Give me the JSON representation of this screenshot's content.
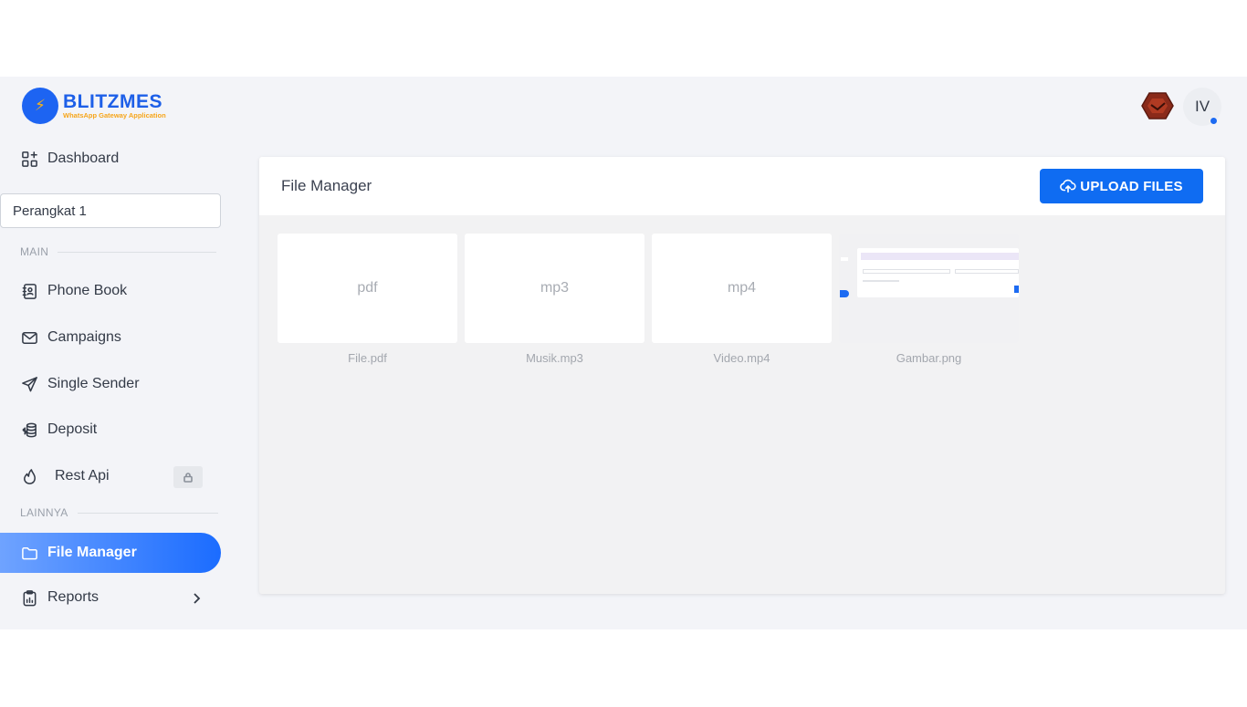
{
  "brand": {
    "name": "BLITZMES",
    "tagline": "WhatsApp Gateway Application",
    "colors": {
      "primary": "#1d64f2",
      "accent": "#f6a51a"
    }
  },
  "sidebar": {
    "dashboard_label": "Dashboard",
    "device_select_value": "Perangkat 1",
    "section_main": "MAIN",
    "section_other": "LAINNYA",
    "items": {
      "phone_book": "Phone Book",
      "campaigns": "Campaigns",
      "single_sender": "Single Sender",
      "deposit": "Deposit",
      "rest_api": "Rest Api",
      "file_manager": "File Manager",
      "reports": "Reports"
    },
    "icons": {
      "dashboard": "dashboard-grid-icon",
      "phone_book": "address-book-icon",
      "campaigns": "mail-icon",
      "single_sender": "send-icon",
      "deposit": "coins-icon",
      "rest_api": "fire-icon",
      "file_manager": "folder-icon",
      "reports": "clipboard-icon",
      "lock": "lock-icon",
      "chevron": "chevron-right-icon"
    }
  },
  "header": {
    "avatar_initials": "IV"
  },
  "main": {
    "title": "File Manager",
    "upload_label": "UPLOAD FILES",
    "files": [
      {
        "type_label": "pdf",
        "name": "File.pdf"
      },
      {
        "type_label": "mp3",
        "name": "Musik.mp3"
      },
      {
        "type_label": "mp4",
        "name": "Video.mp4"
      },
      {
        "type_label": "",
        "name": "Gambar.png"
      }
    ]
  }
}
